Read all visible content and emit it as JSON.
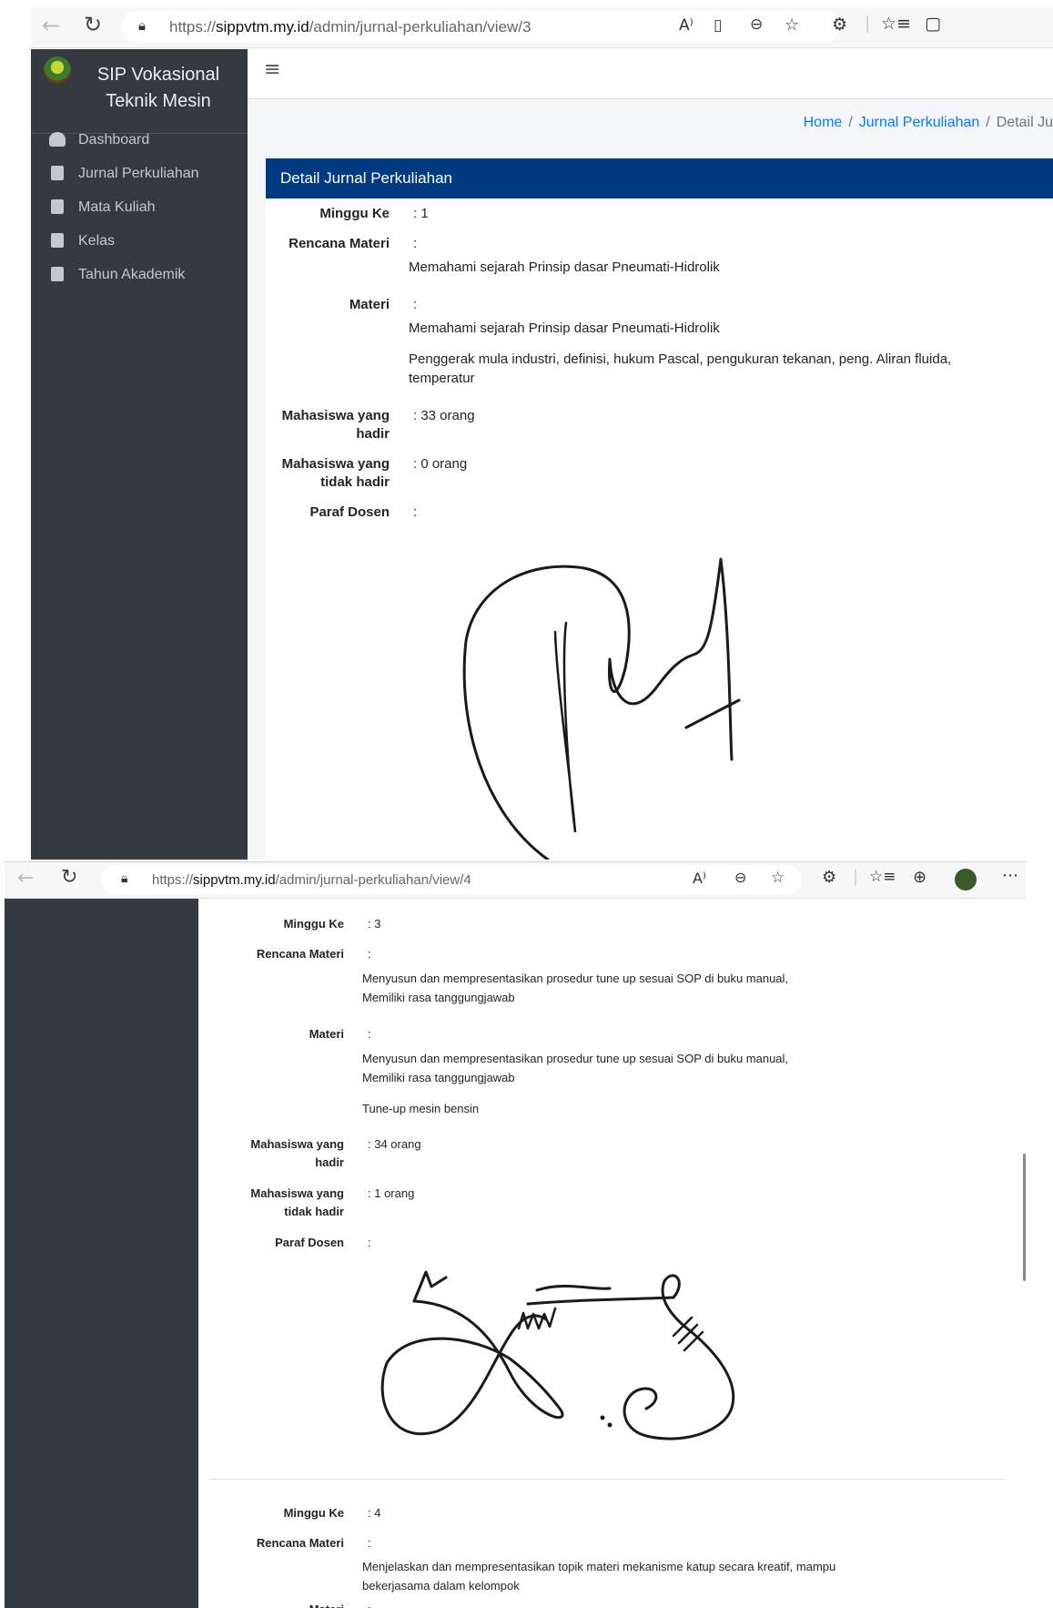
{
  "window1": {
    "url_prefix": "https://",
    "url_host": "sippvtm.my.id",
    "url_path": "/admin/jurnal-perkuliahan/view/3",
    "brand": "SIP Vokasional Teknik Mesin",
    "menu": [
      {
        "label": "Dashboard",
        "icon": "dashboard-gauge-icon"
      },
      {
        "label": "Jurnal Perkuliahan",
        "icon": "book-icon"
      },
      {
        "label": "Mata Kuliah",
        "icon": "book-icon"
      },
      {
        "label": "Kelas",
        "icon": "book-icon"
      },
      {
        "label": "Tahun Akademik",
        "icon": "book-icon"
      }
    ],
    "breadcrumb": {
      "home": "Home",
      "jurnal": "Jurnal Perkuliahan",
      "current": "Detail Ju",
      "separator": "/"
    },
    "card_title": "Detail Jurnal Perkuliahan",
    "labels": {
      "minggu": "Minggu Ke",
      "rencana": "Rencana Materi",
      "materi": "Materi",
      "hadir_1": "Mahasiswa yang",
      "hadir_2": "hadir",
      "tidak_hadir_1": "Mahasiswa yang",
      "tidak_hadir_2": "tidak hadir",
      "paraf": "Paraf Dosen"
    },
    "entry": {
      "minggu": ": 1",
      "colon": ":",
      "rencana": "Memahami sejarah Prinsip dasar Pneumati-Hidrolik",
      "materi_1": "Memahami sejarah Prinsip dasar Pneumati-Hidrolik",
      "materi_2a": "Penggerak mula industri, definisi, hukum Pascal, pengukuran tekanan, peng. Aliran fluida,",
      "materi_2b": "temperatur",
      "hadir": ": 33 orang",
      "tidak_hadir": ": 0 orang"
    }
  },
  "window2": {
    "url_prefix": "https://",
    "url_host": "sippvtm.my.id",
    "url_path": "/admin/jurnal-perkuliahan/view/4",
    "labels": {
      "minggu": "Minggu Ke",
      "rencana": "Rencana Materi",
      "materi": "Materi",
      "hadir_1": "Mahasiswa yang",
      "hadir_2": "hadir",
      "tidak_hadir_1": "Mahasiswa yang",
      "tidak_hadir_2": "tidak hadir",
      "paraf": "Paraf Dosen"
    },
    "entry1": {
      "minggu": ": 3",
      "colon": ":",
      "rencana_a": "Menyusun dan mempresentasikan prosedur tune up sesuai SOP di buku manual,",
      "rencana_b": "Memiliki rasa tanggungjawab",
      "materi_a": "Menyusun dan mempresentasikan prosedur tune up sesuai SOP di buku manual,",
      "materi_b": "Memiliki rasa tanggungjawab",
      "materi_c": "Tune-up mesin bensin",
      "hadir": ": 34 orang",
      "tidak_hadir": ": 1 orang"
    },
    "entry2": {
      "minggu": ": 4",
      "colon": ":",
      "rencana_a": "Menjelaskan dan mempresentasikan topik materi mekanisme katup secara kreatif, mampu",
      "rencana_b": "bekerjasama dalam kelompok"
    }
  },
  "colors": {
    "sidebar": "#343a40",
    "card_header": "#003a80",
    "link": "#007bff",
    "content_bg": "#f4f6f9"
  }
}
